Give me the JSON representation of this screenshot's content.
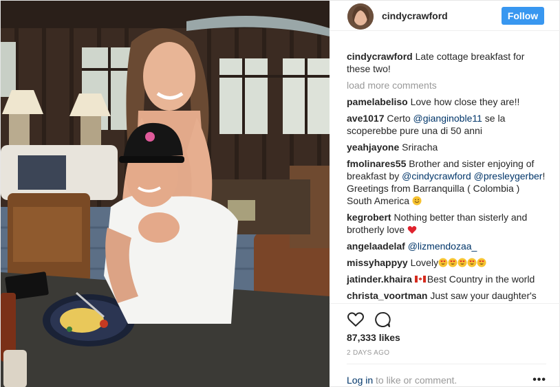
{
  "post": {
    "username": "cindycrawford",
    "follow_label": "Follow",
    "caption": {
      "user": "cindycrawford",
      "text": "Late cottage breakfast for these two!"
    },
    "load_more": "load more comments",
    "comments": [
      {
        "user": "pamelabeliso",
        "text": "Love how close they are!!"
      },
      {
        "user": "ave1017",
        "pre": "Certo ",
        "mention": "@gianginoble11",
        "post": " se la scoperebbe pure una di 50 anni"
      },
      {
        "user": "yeahjayone",
        "text": "Sriracha"
      },
      {
        "user": "fmolinares55",
        "pre": "Brother and sister enjoying of breakfast by ",
        "mention": "@cindycrawford",
        "mention2": "@presleygerber",
        "post": "! Greetings from Barranquilla ( Colombia ) South America "
      },
      {
        "user": "kegrobert",
        "text": "Nothing better than sisterly and brotherly love "
      },
      {
        "user": "angelaadelaf",
        "mention": "@lizmendozaa_"
      },
      {
        "user": "missyhappyy",
        "text": "Lovely"
      },
      {
        "user": "jatinder.khaira",
        "text": "Best Country in the world"
      },
      {
        "user": "christa_voortman",
        "text": "Just saw your daughter's"
      }
    ],
    "likes": "87,333 likes",
    "timestamp": "2 DAYS AGO",
    "login_link": "Log in",
    "login_rest": " to like or comment.",
    "more_label": "•••",
    "icons": {
      "like": "heart-icon",
      "comment": "speech-bubble-icon",
      "more": "ellipsis-icon"
    },
    "colors": {
      "follow": "#3897f0",
      "mention": "#003569",
      "muted": "#999999"
    }
  }
}
